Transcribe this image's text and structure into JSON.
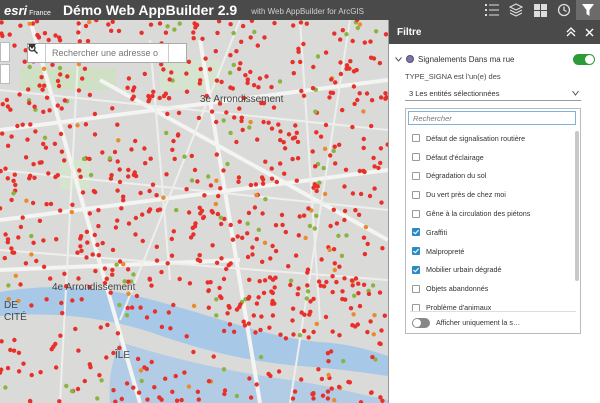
{
  "header": {
    "logo_text": "esri",
    "logo_suffix": "France",
    "title": "Démo Web AppBuilder 2.9",
    "subtitle": "with Web AppBuilder for ArcGIS",
    "tools": [
      "list-icon",
      "layers-icon",
      "grid-icon",
      "history-icon",
      "filter-icon"
    ]
  },
  "map": {
    "search": {
      "placeholder": "Rechercher une adresse o"
    },
    "labels": {
      "arr3": "3e Arrondissement",
      "arr4": "4e Arrondissement",
      "ile": "ÎLE",
      "cite": "CITÉ",
      "de": "DE"
    },
    "point_colors": {
      "red": "#e8302a",
      "green": "#8ab340",
      "orange": "#e88b2e"
    }
  },
  "panel": {
    "title": "Filtre",
    "filter_name": "Signalements Dans ma rue",
    "toggle_on": true,
    "condition": "TYPE_SIGNA est l'un(e) des",
    "selected_text": "3 Les entités sélectionnées",
    "list_search_placeholder": "Rechercher",
    "options": [
      {
        "label": "Défaut de signalisation routière",
        "checked": false
      },
      {
        "label": "Défaut d'éclairage",
        "checked": false
      },
      {
        "label": "Dégradation du sol",
        "checked": false
      },
      {
        "label": "Du vert près de chez moi",
        "checked": false
      },
      {
        "label": "Gêne à la circulation des piétons",
        "checked": false
      },
      {
        "label": "Graffiti",
        "checked": true
      },
      {
        "label": "Malpropreté",
        "checked": true
      },
      {
        "label": "Mobilier urbain dégradé",
        "checked": true
      },
      {
        "label": "Objets abandonnés",
        "checked": false
      },
      {
        "label": "Problème d'animaux",
        "checked": false
      }
    ],
    "only_label": "Afficher uniquement la s…"
  }
}
